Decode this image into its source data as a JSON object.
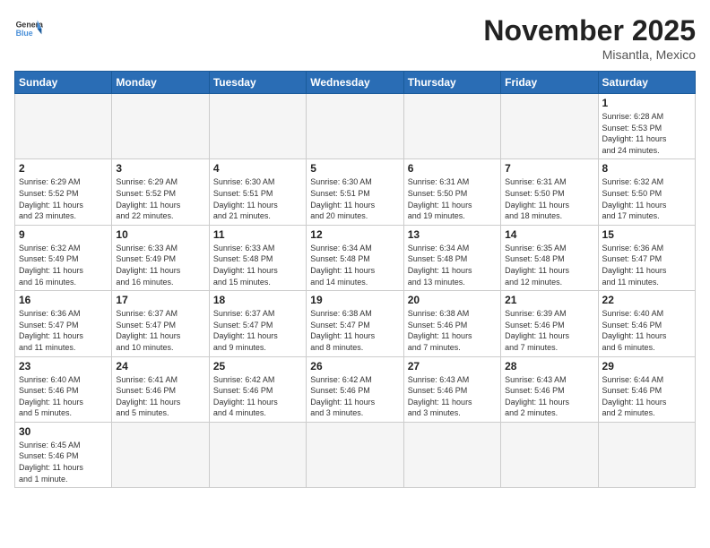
{
  "header": {
    "logo_general": "General",
    "logo_blue": "Blue",
    "month_title": "November 2025",
    "location": "Misantla, Mexico"
  },
  "weekdays": [
    "Sunday",
    "Monday",
    "Tuesday",
    "Wednesday",
    "Thursday",
    "Friday",
    "Saturday"
  ],
  "days": [
    {
      "date": null,
      "info": null
    },
    {
      "date": null,
      "info": null
    },
    {
      "date": null,
      "info": null
    },
    {
      "date": null,
      "info": null
    },
    {
      "date": null,
      "info": null
    },
    {
      "date": null,
      "info": null
    },
    {
      "date": "1",
      "info": "Sunrise: 6:28 AM\nSunset: 5:53 PM\nDaylight: 11 hours\nand 24 minutes."
    },
    {
      "date": "2",
      "info": "Sunrise: 6:29 AM\nSunset: 5:52 PM\nDaylight: 11 hours\nand 23 minutes."
    },
    {
      "date": "3",
      "info": "Sunrise: 6:29 AM\nSunset: 5:52 PM\nDaylight: 11 hours\nand 22 minutes."
    },
    {
      "date": "4",
      "info": "Sunrise: 6:30 AM\nSunset: 5:51 PM\nDaylight: 11 hours\nand 21 minutes."
    },
    {
      "date": "5",
      "info": "Sunrise: 6:30 AM\nSunset: 5:51 PM\nDaylight: 11 hours\nand 20 minutes."
    },
    {
      "date": "6",
      "info": "Sunrise: 6:31 AM\nSunset: 5:50 PM\nDaylight: 11 hours\nand 19 minutes."
    },
    {
      "date": "7",
      "info": "Sunrise: 6:31 AM\nSunset: 5:50 PM\nDaylight: 11 hours\nand 18 minutes."
    },
    {
      "date": "8",
      "info": "Sunrise: 6:32 AM\nSunset: 5:50 PM\nDaylight: 11 hours\nand 17 minutes."
    },
    {
      "date": "9",
      "info": "Sunrise: 6:32 AM\nSunset: 5:49 PM\nDaylight: 11 hours\nand 16 minutes."
    },
    {
      "date": "10",
      "info": "Sunrise: 6:33 AM\nSunset: 5:49 PM\nDaylight: 11 hours\nand 16 minutes."
    },
    {
      "date": "11",
      "info": "Sunrise: 6:33 AM\nSunset: 5:48 PM\nDaylight: 11 hours\nand 15 minutes."
    },
    {
      "date": "12",
      "info": "Sunrise: 6:34 AM\nSunset: 5:48 PM\nDaylight: 11 hours\nand 14 minutes."
    },
    {
      "date": "13",
      "info": "Sunrise: 6:34 AM\nSunset: 5:48 PM\nDaylight: 11 hours\nand 13 minutes."
    },
    {
      "date": "14",
      "info": "Sunrise: 6:35 AM\nSunset: 5:48 PM\nDaylight: 11 hours\nand 12 minutes."
    },
    {
      "date": "15",
      "info": "Sunrise: 6:36 AM\nSunset: 5:47 PM\nDaylight: 11 hours\nand 11 minutes."
    },
    {
      "date": "16",
      "info": "Sunrise: 6:36 AM\nSunset: 5:47 PM\nDaylight: 11 hours\nand 11 minutes."
    },
    {
      "date": "17",
      "info": "Sunrise: 6:37 AM\nSunset: 5:47 PM\nDaylight: 11 hours\nand 10 minutes."
    },
    {
      "date": "18",
      "info": "Sunrise: 6:37 AM\nSunset: 5:47 PM\nDaylight: 11 hours\nand 9 minutes."
    },
    {
      "date": "19",
      "info": "Sunrise: 6:38 AM\nSunset: 5:47 PM\nDaylight: 11 hours\nand 8 minutes."
    },
    {
      "date": "20",
      "info": "Sunrise: 6:38 AM\nSunset: 5:46 PM\nDaylight: 11 hours\nand 7 minutes."
    },
    {
      "date": "21",
      "info": "Sunrise: 6:39 AM\nSunset: 5:46 PM\nDaylight: 11 hours\nand 7 minutes."
    },
    {
      "date": "22",
      "info": "Sunrise: 6:40 AM\nSunset: 5:46 PM\nDaylight: 11 hours\nand 6 minutes."
    },
    {
      "date": "23",
      "info": "Sunrise: 6:40 AM\nSunset: 5:46 PM\nDaylight: 11 hours\nand 5 minutes."
    },
    {
      "date": "24",
      "info": "Sunrise: 6:41 AM\nSunset: 5:46 PM\nDaylight: 11 hours\nand 5 minutes."
    },
    {
      "date": "25",
      "info": "Sunrise: 6:42 AM\nSunset: 5:46 PM\nDaylight: 11 hours\nand 4 minutes."
    },
    {
      "date": "26",
      "info": "Sunrise: 6:42 AM\nSunset: 5:46 PM\nDaylight: 11 hours\nand 3 minutes."
    },
    {
      "date": "27",
      "info": "Sunrise: 6:43 AM\nSunset: 5:46 PM\nDaylight: 11 hours\nand 3 minutes."
    },
    {
      "date": "28",
      "info": "Sunrise: 6:43 AM\nSunset: 5:46 PM\nDaylight: 11 hours\nand 2 minutes."
    },
    {
      "date": "29",
      "info": "Sunrise: 6:44 AM\nSunset: 5:46 PM\nDaylight: 11 hours\nand 2 minutes."
    },
    {
      "date": "30",
      "info": "Sunrise: 6:45 AM\nSunset: 5:46 PM\nDaylight: 11 hours\nand 1 minute."
    },
    {
      "date": null,
      "info": null
    },
    {
      "date": null,
      "info": null
    },
    {
      "date": null,
      "info": null
    },
    {
      "date": null,
      "info": null
    },
    {
      "date": null,
      "info": null
    },
    {
      "date": null,
      "info": null
    }
  ]
}
